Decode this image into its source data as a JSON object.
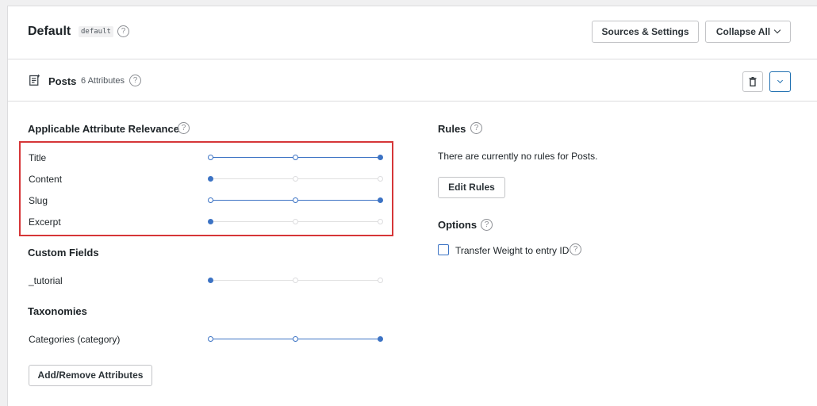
{
  "engine": {
    "title": "Default",
    "slug": "default"
  },
  "header_buttons": {
    "sources_settings": "Sources & Settings",
    "collapse_all": "Collapse All"
  },
  "source": {
    "title": "Posts",
    "count": "6 Attributes"
  },
  "relevance": {
    "title": "Applicable Attribute Relevance",
    "attributes": [
      {
        "label": "Title",
        "level": 3
      },
      {
        "label": "Content",
        "level": 1
      },
      {
        "label": "Slug",
        "level": 3
      },
      {
        "label": "Excerpt",
        "level": 1
      }
    ]
  },
  "custom_fields": {
    "title": "Custom Fields",
    "items": [
      {
        "label": "_tutorial",
        "level": 1
      }
    ]
  },
  "taxonomies": {
    "title": "Taxonomies",
    "items": [
      {
        "label": "Categories (category)",
        "level": 3
      }
    ]
  },
  "add_remove_label": "Add/Remove Attributes",
  "rules": {
    "title": "Rules",
    "text": "There are currently no rules for Posts.",
    "edit_label": "Edit Rules"
  },
  "options": {
    "title": "Options",
    "transfer_weight_label": "Transfer Weight to entry ID",
    "transfer_weight_checked": false
  },
  "help_glyph": "?",
  "colors": {
    "accent": "#3c73c4",
    "highlight": "#d63638",
    "border": "#dcdcde"
  },
  "icons": {
    "help": "help-circle-icon",
    "trash": "trash-icon",
    "chevron": "chevron-down-icon",
    "document": "document-icon"
  }
}
